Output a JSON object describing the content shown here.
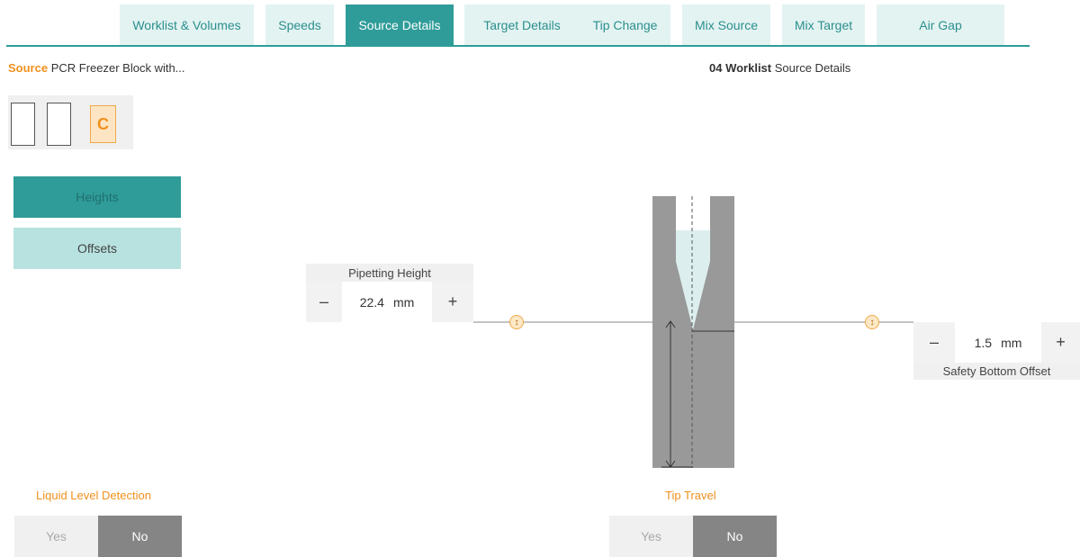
{
  "tabs": [
    {
      "label": "Worklist & Volumes",
      "active": false
    },
    {
      "label": "Speeds",
      "active": false
    },
    {
      "label": "Source Details",
      "active": true
    },
    {
      "label": "Target Details",
      "active": false
    },
    {
      "label": "Tip Change",
      "active": false
    },
    {
      "label": "Mix Source",
      "active": false
    },
    {
      "label": "Mix Target",
      "active": false
    },
    {
      "label": "Air Gap",
      "active": false
    }
  ],
  "source": {
    "key": "Source",
    "value": "PCR Freezer Block with..."
  },
  "worklist": {
    "key": "04 Worklist",
    "value": "Source Details"
  },
  "plate": {
    "selected_slot": "C"
  },
  "side_buttons": {
    "heights": "Heights",
    "offsets": "Offsets"
  },
  "pipetting_height": {
    "label": "Pipetting Height",
    "minus": "–",
    "value": "22.4",
    "unit": "mm",
    "plus": "+"
  },
  "safety_bottom_offset": {
    "label": "Safety Bottom Offset",
    "minus": "–",
    "value": "1.5",
    "unit": "mm",
    "plus": "+"
  },
  "liquid_level_detection": {
    "label": "Liquid Level Detection",
    "yes": "Yes",
    "no": "No",
    "selected": "No"
  },
  "tip_travel": {
    "label": "Tip Travel",
    "yes": "Yes",
    "no": "No",
    "selected": "No"
  },
  "colors": {
    "accent": "#2f9c99",
    "accent_light": "#b7e2e0",
    "orange": "#f0901e",
    "selected_dark": "#858585"
  },
  "icons": {
    "drag_handle": "vertical-resize-icon"
  }
}
